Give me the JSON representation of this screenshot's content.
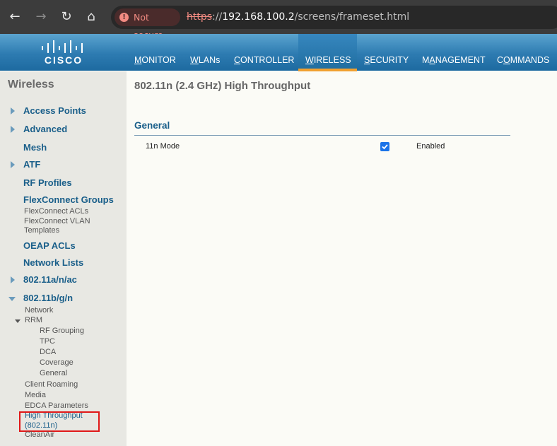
{
  "browser": {
    "security_label": "Not secure",
    "url_scheme": "https",
    "url_sep": "://",
    "url_host": "192.168.100.2",
    "url_path": "/screens/frameset.html",
    "icons": [
      "back-icon",
      "forward-icon",
      "reload-icon",
      "home-icon",
      "warning-icon"
    ]
  },
  "header": {
    "logo_text": "CISCO",
    "menu": [
      {
        "first": "M",
        "rest": "ONITOR"
      },
      {
        "first": "W",
        "rest": "LANs"
      },
      {
        "first": "C",
        "rest": "ONTROLLER"
      },
      {
        "first": "W",
        "rest": "IRELESS"
      },
      {
        "first": "S",
        "rest": "ECURITY"
      },
      {
        "pre": "M",
        "first": "A",
        "rest": "NAGEMENT"
      },
      {
        "pre": "C",
        "first": "O",
        "rest": "MMANDS"
      }
    ],
    "active_menu": "WIRELESS",
    "accent_color": "#f0a030"
  },
  "sidebar": {
    "title": "Wireless",
    "access_points": "Access Points",
    "advanced": "Advanced",
    "mesh": "Mesh",
    "atf": "ATF",
    "rf_profiles": "RF Profiles",
    "flexconnect_groups": "FlexConnect Groups",
    "flexconnect_acls": "FlexConnect ACLs",
    "flexconnect_vlan_1": "FlexConnect VLAN",
    "flexconnect_vlan_2": "Templates",
    "oeap_acls": "OEAP ACLs",
    "network_lists": "Network Lists",
    "band_5": "802.11a/n/ac",
    "band_24": "802.11b/g/n",
    "network": "Network",
    "rrm": "RRM",
    "rf_grouping": "RF Grouping",
    "tpc": "TPC",
    "dca": "DCA",
    "coverage": "Coverage",
    "general": "General",
    "client_roaming": "Client Roaming",
    "media": "Media",
    "edca": "EDCA Parameters",
    "ht_1": "High Throughput",
    "ht_2": "(802.11n)",
    "cleanair": "CleanAir"
  },
  "main": {
    "title": "802.11n (2.4 GHz) High Throughput",
    "section": "General",
    "row_label": "11n Mode",
    "checked": true,
    "row_value": "Enabled"
  }
}
